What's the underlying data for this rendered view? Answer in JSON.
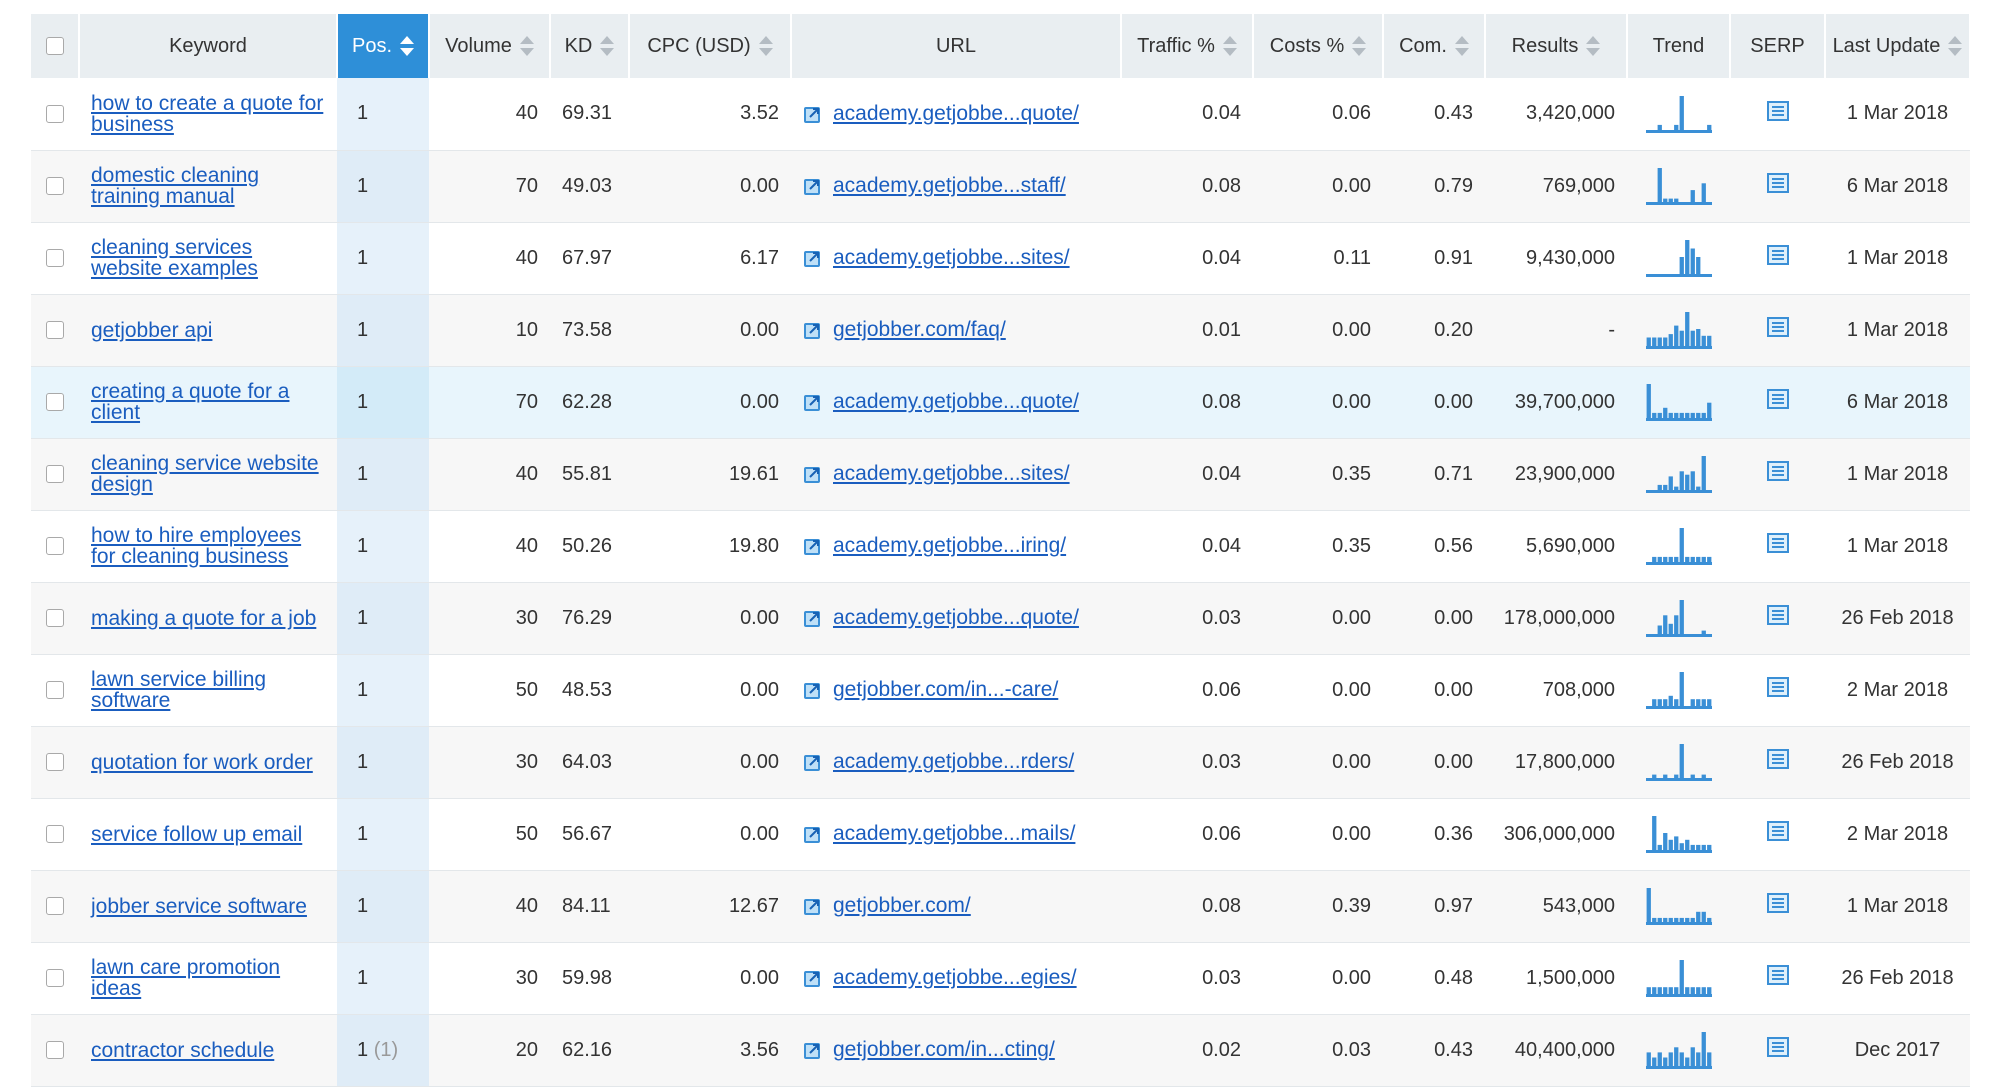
{
  "table": {
    "headers": {
      "keyword": "Keyword",
      "pos": "Pos.",
      "volume": "Volume",
      "kd": "KD",
      "cpc": "CPC (USD)",
      "url": "URL",
      "traffic": "Traffic %",
      "costs": "Costs %",
      "com": "Com.",
      "results": "Results",
      "trend": "Trend",
      "serp": "SERP",
      "last_update": "Last Update"
    },
    "accent_color": "#2e8fd8",
    "link_color": "#1a5dbf",
    "rows": [
      {
        "keyword": "how to create a quote for business",
        "pos": "1",
        "pos_prev": "",
        "volume": "40",
        "kd": "69.31",
        "cpc": "3.52",
        "url": "academy.getjobbe...quote/",
        "traffic": "0.04",
        "costs": "0.06",
        "com": "0.43",
        "results": "3,420,000",
        "last_update": "1 Mar 2018",
        "trend": [
          0,
          0,
          0.15,
          0,
          0,
          0.15,
          1,
          0,
          0,
          0,
          0,
          0.15
        ]
      },
      {
        "keyword": "domestic cleaning training manual",
        "pos": "1",
        "pos_prev": "",
        "volume": "70",
        "kd": "49.03",
        "cpc": "0.00",
        "url": "academy.getjobbe...staff/",
        "traffic": "0.08",
        "costs": "0.00",
        "com": "0.79",
        "results": "769,000",
        "last_update": "6 Mar 2018",
        "trend": [
          0,
          0,
          1,
          0.1,
          0.1,
          0.1,
          0,
          0,
          0.35,
          0,
          0.55,
          0
        ]
      },
      {
        "keyword": "cleaning services website examples",
        "pos": "1",
        "pos_prev": "",
        "volume": "40",
        "kd": "67.97",
        "cpc": "6.17",
        "url": "academy.getjobbe...sites/",
        "traffic": "0.04",
        "costs": "0.11",
        "com": "0.91",
        "results": "9,430,000",
        "last_update": "1 Mar 2018",
        "trend": [
          0,
          0,
          0,
          0,
          0,
          0,
          0.5,
          1,
          0.75,
          0.5,
          0,
          0
        ]
      },
      {
        "keyword": "getjobber api",
        "pos": "1",
        "pos_prev": "",
        "volume": "10",
        "kd": "73.58",
        "cpc": "0.00",
        "url": "getjobber.com/faq/",
        "traffic": "0.01",
        "costs": "0.00",
        "com": "0.20",
        "results": "-",
        "last_update": "1 Mar 2018",
        "trend": [
          0.25,
          0.25,
          0.25,
          0.25,
          0.35,
          0.6,
          0.45,
          1,
          0.45,
          0.5,
          0.3,
          0.3
        ]
      },
      {
        "keyword": "creating a quote for a client",
        "pos": "1",
        "pos_prev": "",
        "volume": "70",
        "kd": "62.28",
        "cpc": "0.00",
        "url": "academy.getjobbe...quote/",
        "traffic": "0.08",
        "costs": "0.00",
        "com": "0.00",
        "results": "39,700,000",
        "last_update": "6 Mar 2018",
        "trend": [
          1,
          0.15,
          0.15,
          0.3,
          0.15,
          0.15,
          0.15,
          0.15,
          0.15,
          0.15,
          0.15,
          0.45
        ]
      },
      {
        "keyword": "cleaning service website design",
        "pos": "1",
        "pos_prev": "",
        "volume": "40",
        "kd": "55.81",
        "cpc": "19.61",
        "url": "academy.getjobbe...sites/",
        "traffic": "0.04",
        "costs": "0.35",
        "com": "0.71",
        "results": "23,900,000",
        "last_update": "1 Mar 2018",
        "trend": [
          0,
          0,
          0.15,
          0.15,
          0.4,
          0.1,
          0.55,
          0.45,
          0.55,
          0.1,
          1,
          0
        ]
      },
      {
        "keyword": "how to hire employees for cleaning business",
        "pos": "1",
        "pos_prev": "",
        "volume": "40",
        "kd": "50.26",
        "cpc": "19.80",
        "url": "academy.getjobbe...iring/",
        "traffic": "0.04",
        "costs": "0.35",
        "com": "0.56",
        "results": "5,690,000",
        "last_update": "1 Mar 2018",
        "trend": [
          0,
          0.15,
          0.15,
          0.15,
          0.15,
          0.15,
          1,
          0.15,
          0.15,
          0.15,
          0.15,
          0.15
        ]
      },
      {
        "keyword": "making a quote for a job",
        "pos": "1",
        "pos_prev": "",
        "volume": "30",
        "kd": "76.29",
        "cpc": "0.00",
        "url": "academy.getjobbe...quote/",
        "traffic": "0.03",
        "costs": "0.00",
        "com": "0.00",
        "results": "178,000,000",
        "last_update": "26 Feb 2018",
        "trend": [
          0,
          0,
          0.25,
          0.55,
          0.3,
          0.55,
          1,
          0,
          0,
          0,
          0.1,
          0
        ]
      },
      {
        "keyword": "lawn service billing software",
        "pos": "1",
        "pos_prev": "",
        "volume": "50",
        "kd": "48.53",
        "cpc": "0.00",
        "url": "getjobber.com/in...-care/",
        "traffic": "0.06",
        "costs": "0.00",
        "com": "0.00",
        "results": "708,000",
        "last_update": "2 Mar 2018",
        "trend": [
          0,
          0.2,
          0.2,
          0.2,
          0.3,
          0.2,
          1,
          0,
          0.2,
          0.2,
          0.2,
          0.2
        ]
      },
      {
        "keyword": "quotation for work order",
        "pos": "1",
        "pos_prev": "",
        "volume": "30",
        "kd": "64.03",
        "cpc": "0.00",
        "url": "academy.getjobbe...rders/",
        "traffic": "0.03",
        "costs": "0.00",
        "com": "0.00",
        "results": "17,800,000",
        "last_update": "26 Feb 2018",
        "trend": [
          0,
          0.1,
          0,
          0.1,
          0,
          0.1,
          1,
          0,
          0.1,
          0,
          0.1,
          0
        ]
      },
      {
        "keyword": "service follow up email",
        "pos": "1",
        "pos_prev": "",
        "volume": "50",
        "kd": "56.67",
        "cpc": "0.00",
        "url": "academy.getjobbe...mails/",
        "traffic": "0.06",
        "costs": "0.00",
        "com": "0.36",
        "results": "306,000,000",
        "last_update": "2 Mar 2018",
        "trend": [
          0,
          1,
          0.15,
          0.5,
          0.3,
          0.4,
          0.2,
          0.3,
          0.15,
          0.15,
          0.15,
          0.15
        ]
      },
      {
        "keyword": "jobber service software",
        "pos": "1",
        "pos_prev": "",
        "volume": "40",
        "kd": "84.11",
        "cpc": "12.67",
        "url": "getjobber.com/",
        "traffic": "0.08",
        "costs": "0.39",
        "com": "0.97",
        "results": "543,000",
        "last_update": "1 Mar 2018",
        "trend": [
          1,
          0.12,
          0.12,
          0.12,
          0.12,
          0.12,
          0.12,
          0.12,
          0.12,
          0.3,
          0.3,
          0.12
        ]
      },
      {
        "keyword": "lawn care promotion ideas",
        "pos": "1",
        "pos_prev": "",
        "volume": "30",
        "kd": "59.98",
        "cpc": "0.00",
        "url": "academy.getjobbe...egies/",
        "traffic": "0.03",
        "costs": "0.00",
        "com": "0.48",
        "results": "1,500,000",
        "last_update": "26 Feb 2018",
        "trend": [
          0.2,
          0.2,
          0.2,
          0.2,
          0.2,
          0.2,
          1,
          0.2,
          0.2,
          0.2,
          0.2,
          0.2
        ]
      },
      {
        "keyword": "contractor schedule",
        "pos": "1",
        "pos_prev": "(1)",
        "volume": "20",
        "kd": "62.16",
        "cpc": "3.56",
        "url": "getjobber.com/in...cting/",
        "traffic": "0.02",
        "costs": "0.03",
        "com": "0.43",
        "results": "40,400,000",
        "last_update": "Dec 2017",
        "trend": [
          0.4,
          0.25,
          0.4,
          0.25,
          0.4,
          0.55,
          0.4,
          0.25,
          0.55,
          0.4,
          1,
          0.4
        ]
      }
    ]
  }
}
